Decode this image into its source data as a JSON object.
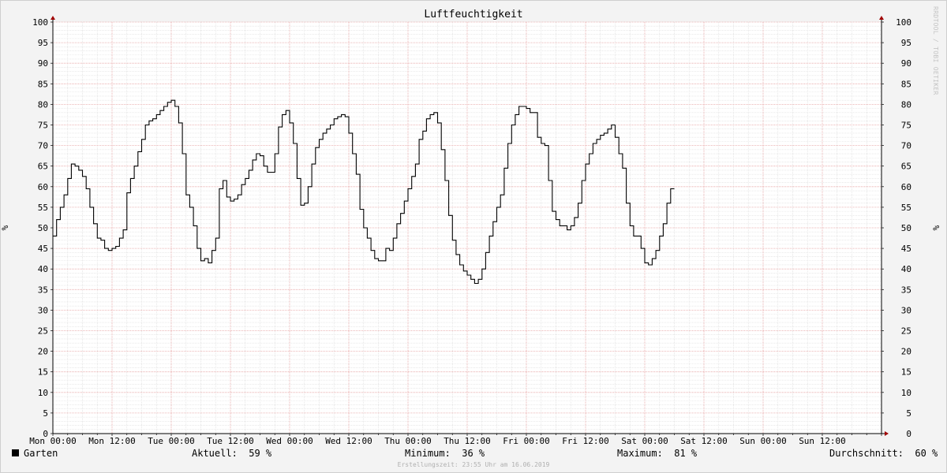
{
  "chart_data": {
    "type": "line",
    "title": "Luftfeuchtigkeit",
    "ylabel": "%",
    "ylim": [
      0,
      100
    ],
    "yticks": [
      0,
      5,
      10,
      15,
      20,
      25,
      30,
      35,
      40,
      45,
      50,
      55,
      60,
      65,
      70,
      75,
      80,
      85,
      90,
      95,
      100
    ],
    "xlim": [
      0,
      168
    ],
    "x_unit": "hours since Mon 00:00",
    "xtick_labels": [
      "Mon 00:00",
      "Mon 12:00",
      "Tue 00:00",
      "Tue 12:00",
      "Wed 00:00",
      "Wed 12:00",
      "Thu 00:00",
      "Thu 12:00",
      "Fri 00:00",
      "Fri 12:00",
      "Sat 00:00",
      "Sat 12:00",
      "Sun 00:00",
      "Sun 12:00"
    ],
    "grid": true,
    "step": true,
    "series": [
      {
        "name": "Garten",
        "color": "#000000",
        "points": [
          [
            0,
            48
          ],
          [
            0.75,
            52
          ],
          [
            1.5,
            55
          ],
          [
            2.25,
            58
          ],
          [
            3,
            62
          ],
          [
            3.75,
            65.5
          ],
          [
            4.5,
            65
          ],
          [
            5.25,
            64
          ],
          [
            6,
            62.5
          ],
          [
            6.75,
            59.5
          ],
          [
            7.5,
            55
          ],
          [
            8.25,
            51
          ],
          [
            9,
            47.5
          ],
          [
            9.75,
            47
          ],
          [
            10.5,
            45
          ],
          [
            11.25,
            44.5
          ],
          [
            12,
            45
          ],
          [
            12.75,
            45.5
          ],
          [
            13.5,
            47.5
          ],
          [
            14.25,
            49.5
          ],
          [
            15,
            58.5
          ],
          [
            15.75,
            62
          ],
          [
            16.5,
            65
          ],
          [
            17.25,
            68.5
          ],
          [
            18,
            71.5
          ],
          [
            18.75,
            75
          ],
          [
            19.5,
            76
          ],
          [
            20.25,
            76.5
          ],
          [
            21,
            77.5
          ],
          [
            21.75,
            78.5
          ],
          [
            22.5,
            79.5
          ],
          [
            23.25,
            80.5
          ],
          [
            24,
            81
          ],
          [
            24.75,
            79.5
          ],
          [
            25.5,
            75.5
          ],
          [
            26.25,
            68
          ],
          [
            27,
            58
          ],
          [
            27.75,
            55
          ],
          [
            28.5,
            50.5
          ],
          [
            29.25,
            45
          ],
          [
            30,
            42
          ],
          [
            30.75,
            42.5
          ],
          [
            31.5,
            41.5
          ],
          [
            32.25,
            44.5
          ],
          [
            33,
            47.5
          ],
          [
            33.75,
            59.5
          ],
          [
            34.5,
            61.5
          ],
          [
            35.25,
            57.5
          ],
          [
            36,
            56.5
          ],
          [
            36.75,
            57
          ],
          [
            37.5,
            58
          ],
          [
            38.25,
            60.5
          ],
          [
            39,
            62
          ],
          [
            39.75,
            64
          ],
          [
            40.5,
            66.5
          ],
          [
            41.25,
            68
          ],
          [
            42,
            67.5
          ],
          [
            42.75,
            65
          ],
          [
            43.5,
            63.5
          ],
          [
            44.25,
            63.5
          ],
          [
            45,
            68
          ],
          [
            45.75,
            74.5
          ],
          [
            46.5,
            77.5
          ],
          [
            47.25,
            78.5
          ],
          [
            48,
            75.5
          ],
          [
            48.75,
            70.5
          ],
          [
            49.5,
            62
          ],
          [
            50.25,
            55.5
          ],
          [
            51,
            56
          ],
          [
            51.75,
            60
          ],
          [
            52.5,
            65.5
          ],
          [
            53.25,
            69.5
          ],
          [
            54,
            71.5
          ],
          [
            54.75,
            73
          ],
          [
            55.5,
            74
          ],
          [
            56.25,
            75
          ],
          [
            57,
            76.5
          ],
          [
            57.75,
            77
          ],
          [
            58.5,
            77.5
          ],
          [
            59.25,
            77
          ],
          [
            60,
            73
          ],
          [
            60.75,
            68
          ],
          [
            61.5,
            63
          ],
          [
            62.25,
            54.5
          ],
          [
            63,
            50
          ],
          [
            63.75,
            47.5
          ],
          [
            64.5,
            44.5
          ],
          [
            65.25,
            42.5
          ],
          [
            66,
            42
          ],
          [
            66.75,
            42
          ],
          [
            67.5,
            45
          ],
          [
            68.25,
            44.5
          ],
          [
            69,
            47.5
          ],
          [
            69.75,
            51
          ],
          [
            70.5,
            53.5
          ],
          [
            71.25,
            56.5
          ],
          [
            72,
            59.5
          ],
          [
            72.75,
            62.5
          ],
          [
            73.5,
            65.5
          ],
          [
            74.25,
            71.5
          ],
          [
            75,
            73.5
          ],
          [
            75.75,
            76.5
          ],
          [
            76.5,
            77.5
          ],
          [
            77.25,
            78
          ],
          [
            78,
            75.5
          ],
          [
            78.75,
            69
          ],
          [
            79.5,
            61.5
          ],
          [
            80.25,
            53
          ],
          [
            81,
            47
          ],
          [
            81.75,
            43.5
          ],
          [
            82.5,
            41
          ],
          [
            83.25,
            39.5
          ],
          [
            84,
            38.5
          ],
          [
            84.75,
            37.5
          ],
          [
            85.5,
            36.5
          ],
          [
            86.25,
            37.5
          ],
          [
            87,
            40
          ],
          [
            87.75,
            44
          ],
          [
            88.5,
            48
          ],
          [
            89.25,
            51.5
          ],
          [
            90,
            55
          ],
          [
            90.75,
            58
          ],
          [
            91.5,
            64.5
          ],
          [
            92.25,
            70.5
          ],
          [
            93,
            75
          ],
          [
            93.75,
            77.5
          ],
          [
            94.5,
            79.5
          ],
          [
            95.25,
            79.5
          ],
          [
            96,
            79
          ],
          [
            96.75,
            78
          ],
          [
            97.5,
            78
          ],
          [
            98.25,
            72
          ],
          [
            99,
            70.5
          ],
          [
            99.75,
            70
          ],
          [
            100.5,
            61.5
          ],
          [
            101.25,
            54
          ],
          [
            102,
            52
          ],
          [
            102.75,
            50.5
          ],
          [
            103.5,
            50.5
          ],
          [
            104.25,
            49.5
          ],
          [
            105,
            50.5
          ],
          [
            105.75,
            52.5
          ],
          [
            106.5,
            56
          ],
          [
            107.25,
            61.5
          ],
          [
            108,
            65.5
          ],
          [
            108.75,
            68
          ],
          [
            109.5,
            70.5
          ],
          [
            110.25,
            71.5
          ],
          [
            111,
            72.5
          ],
          [
            111.75,
            73
          ],
          [
            112.5,
            74
          ],
          [
            113.25,
            75
          ],
          [
            114,
            72
          ],
          [
            114.75,
            68
          ],
          [
            115.5,
            64.5
          ],
          [
            116.25,
            56
          ],
          [
            117,
            50.5
          ],
          [
            117.75,
            48
          ],
          [
            118.5,
            48
          ],
          [
            119.25,
            45
          ],
          [
            120,
            41.5
          ],
          [
            120.75,
            41
          ],
          [
            121.5,
            42.5
          ],
          [
            122.25,
            44.5
          ],
          [
            123,
            48
          ],
          [
            123.75,
            51
          ],
          [
            124.5,
            56
          ],
          [
            125.25,
            59.5
          ],
          [
            126,
            59.5
          ]
        ]
      }
    ]
  },
  "legend": {
    "series_label": "Garten",
    "aktuell": "Aktuell:  59 %",
    "minimum": "Minimum:  36 %",
    "maximum": "Maximum:  81 %",
    "durchschnitt": "Durchschnitt:  60 %"
  },
  "watermark": "RRDTOOL / TOBI OETIKER",
  "footer": "Erstellungszeit: 23:55 Uhr am 16.06.2019"
}
